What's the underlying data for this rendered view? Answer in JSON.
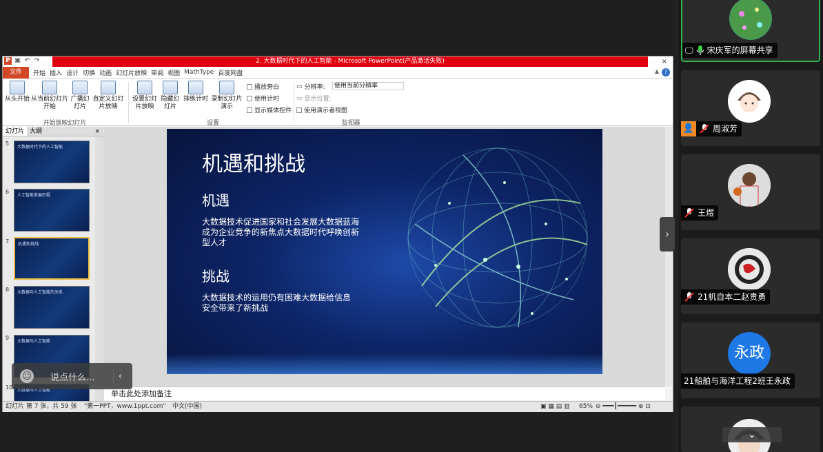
{
  "ppt": {
    "window_title": "2. 大数据时代下的人工智能 - Microsoft PowerPoint(产品激活失败)",
    "close_glyph": "×",
    "menu": [
      "文件",
      "开始",
      "插入",
      "设计",
      "切换",
      "动画",
      "幻灯片放映",
      "审阅",
      "视图",
      "MathType",
      "百度网盘"
    ],
    "ribbon": {
      "from_start": "从头开始",
      "from_current": "从当前幻灯片开始",
      "broadcast": "广播幻灯片",
      "custom": "自定义幻灯片放映",
      "group_start": "开始放映幻灯片",
      "setup": "设置幻灯片放映",
      "hide": "隐藏幻灯片",
      "rehearse": "排练计时",
      "record": "录制幻灯片演示",
      "chk_narration": "播放旁白",
      "chk_timing": "使用计时",
      "chk_media": "显示媒体控件",
      "group_setup": "设置",
      "resolution_label": "分辨率:",
      "resolution_value": "使用当前分辨率",
      "show_on": "显示位置:",
      "presenter_view": "使用演示者视图",
      "group_monitor": "监视器"
    },
    "panes": {
      "tab_slides": "幻灯片",
      "tab_outline": "大纲",
      "close": "×"
    },
    "thumbnails": [
      {
        "num": "5",
        "title": "大数据时代下的人工智能"
      },
      {
        "num": "6",
        "title": "人工智能发展历程"
      },
      {
        "num": "7",
        "title": "机遇和挑战"
      },
      {
        "num": "8",
        "title": "大数据与人工智能的关系"
      },
      {
        "num": "9",
        "title": "大数据与人工智能"
      },
      {
        "num": "10",
        "title": "大数据与人工智能"
      }
    ],
    "slide": {
      "title": "机遇和挑战",
      "h1": "机遇",
      "p1": "大数据技术促进国家和社会发展大数据蓝海成为企业竞争的新焦点大数据时代呼唤创新型人才",
      "h2": "挑战",
      "p2": "大数据技术的运用仍有困难大数据给信息安全带来了新挑战"
    },
    "notes_placeholder": "单击此处添加备注",
    "status": {
      "slide_pos": "幻灯片 第 7 张，共 59 张",
      "theme": "\"第一PPT，www.1ppt.com\"",
      "lang": "中文(中国)",
      "zoom": "65%"
    }
  },
  "chat": {
    "placeholder": "说点什么..."
  },
  "participants": [
    {
      "name": "宋庆军的屏幕共享",
      "mic": "on",
      "active": true
    },
    {
      "name": "周淑芳",
      "mic": "off",
      "host": true
    },
    {
      "name": "王煜",
      "mic": "off"
    },
    {
      "name": "21机自本二赵贵勇",
      "mic": "off"
    },
    {
      "name": "21船舶与海洋工程2班王永政",
      "mic": "none",
      "avatar_text": "永政",
      "avatar_color": "#1e78e6"
    }
  ],
  "colors": {
    "accent_green": "#2fb34a",
    "ppt_red": "#d24726",
    "host_orange": "#f08a24"
  }
}
